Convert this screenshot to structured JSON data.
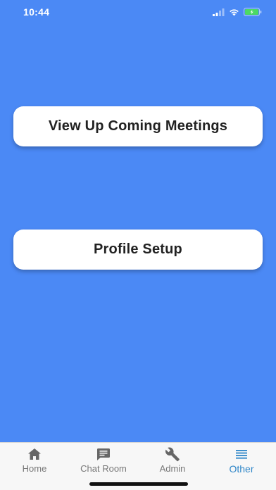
{
  "status_bar": {
    "time": "10:44"
  },
  "buttons": {
    "upcoming_meetings": "View Up Coming Meetings",
    "profile_setup": "Profile Setup"
  },
  "tab_bar": {
    "items": [
      {
        "label": "Home",
        "icon": "home-icon",
        "active": false
      },
      {
        "label": "Chat Room",
        "icon": "chat-icon",
        "active": false
      },
      {
        "label": "Admin",
        "icon": "wrench-icon",
        "active": false
      },
      {
        "label": "Other",
        "icon": "menu-icon",
        "active": true
      }
    ]
  },
  "colors": {
    "background": "#4b89f5",
    "active_tab": "#2f86c8",
    "inactive_tab": "#777777",
    "tab_bar_bg": "#f7f7f7",
    "battery_fill": "#4cd964"
  }
}
